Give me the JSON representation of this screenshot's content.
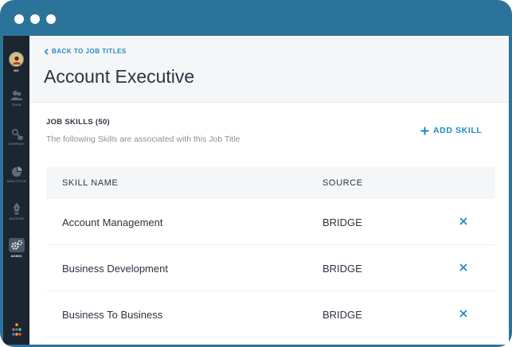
{
  "window": {
    "controls": [
      "dot",
      "dot",
      "dot"
    ]
  },
  "sidebar": {
    "items": [
      {
        "key": "me",
        "label": "ME",
        "icon": "avatar-icon"
      },
      {
        "key": "team",
        "label": "TEAM",
        "icon": "team-icon"
      },
      {
        "key": "company",
        "label": "COMPANY",
        "icon": "company-icon"
      },
      {
        "key": "analytics",
        "label": "ANALYTICS",
        "icon": "analytics-icon"
      },
      {
        "key": "author",
        "label": "AUTHOR",
        "icon": "pen-icon"
      },
      {
        "key": "admin",
        "label": "ADMIN",
        "icon": "gears-icon"
      }
    ],
    "brand_colors": [
      "#f5a623",
      "#e8505b",
      "#1d8ac7",
      "#7cc142"
    ]
  },
  "header": {
    "back_label": "BACK TO JOB TITLES",
    "title": "Account Executive"
  },
  "skills": {
    "section_title": "JOB SKILLS (50)",
    "section_subtitle": "The following Skills are associated with this Job Title",
    "add_label": "ADD SKILL",
    "columns": {
      "name": "SKILL NAME",
      "source": "SOURCE"
    },
    "rows": [
      {
        "name": "Account Management",
        "source": "BRIDGE"
      },
      {
        "name": "Business Development",
        "source": "BRIDGE"
      },
      {
        "name": "Business To Business",
        "source": "BRIDGE"
      }
    ]
  },
  "colors": {
    "frame": "#2c7399",
    "sidebar": "#1b2630",
    "accent": "#1d8ac7",
    "text": "#2b3540"
  }
}
